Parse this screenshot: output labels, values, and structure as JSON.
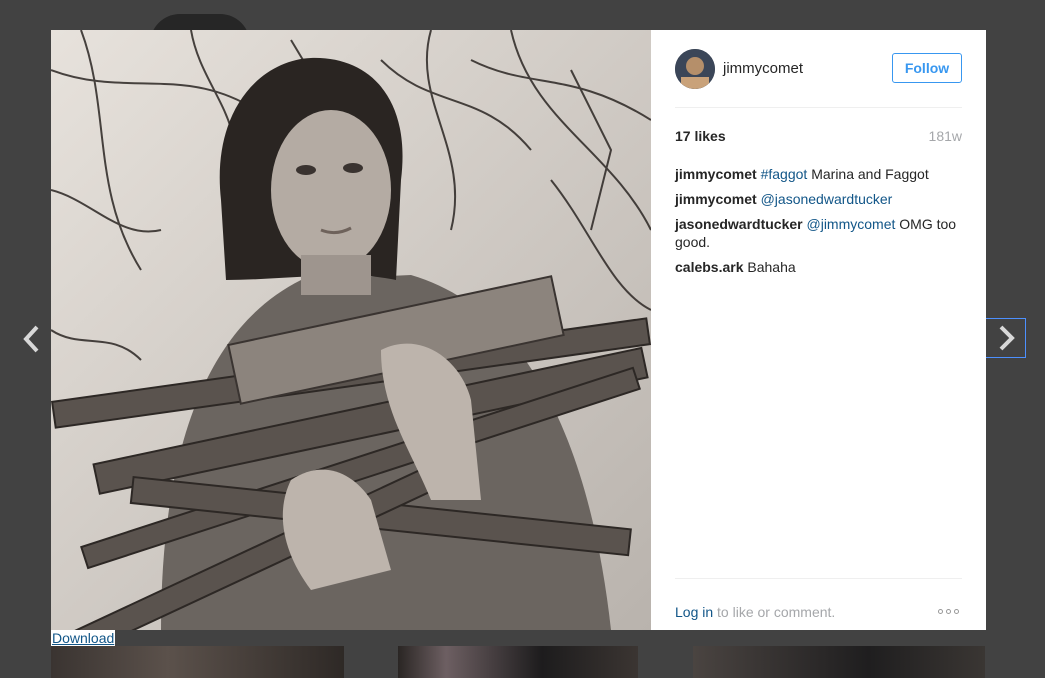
{
  "post": {
    "username": "jimmycomet",
    "follow_label": "Follow",
    "likes": "17 likes",
    "age": "181w"
  },
  "comments": [
    {
      "user": "jimmycomet",
      "tag": "#faggot",
      "text": " Marina and Faggot"
    },
    {
      "user": "jimmycomet",
      "tag": "@jasonedwardtucker",
      "text": ""
    },
    {
      "user": "jasonedwardtucker",
      "tag": "@jimmycomet",
      "text": " OMG too good."
    },
    {
      "user": "calebs.ark",
      "tag": "",
      "text": " Bahaha"
    }
  ],
  "footer": {
    "login_link": "Log in",
    "login_rest": " to like or comment."
  },
  "download_label": "Download",
  "icons": {
    "prev": "chevron-left-icon",
    "next": "chevron-right-icon",
    "more": "more-options-icon"
  },
  "colors": {
    "link": "#125688",
    "follow": "#3897f0",
    "overlay": "#424242"
  }
}
